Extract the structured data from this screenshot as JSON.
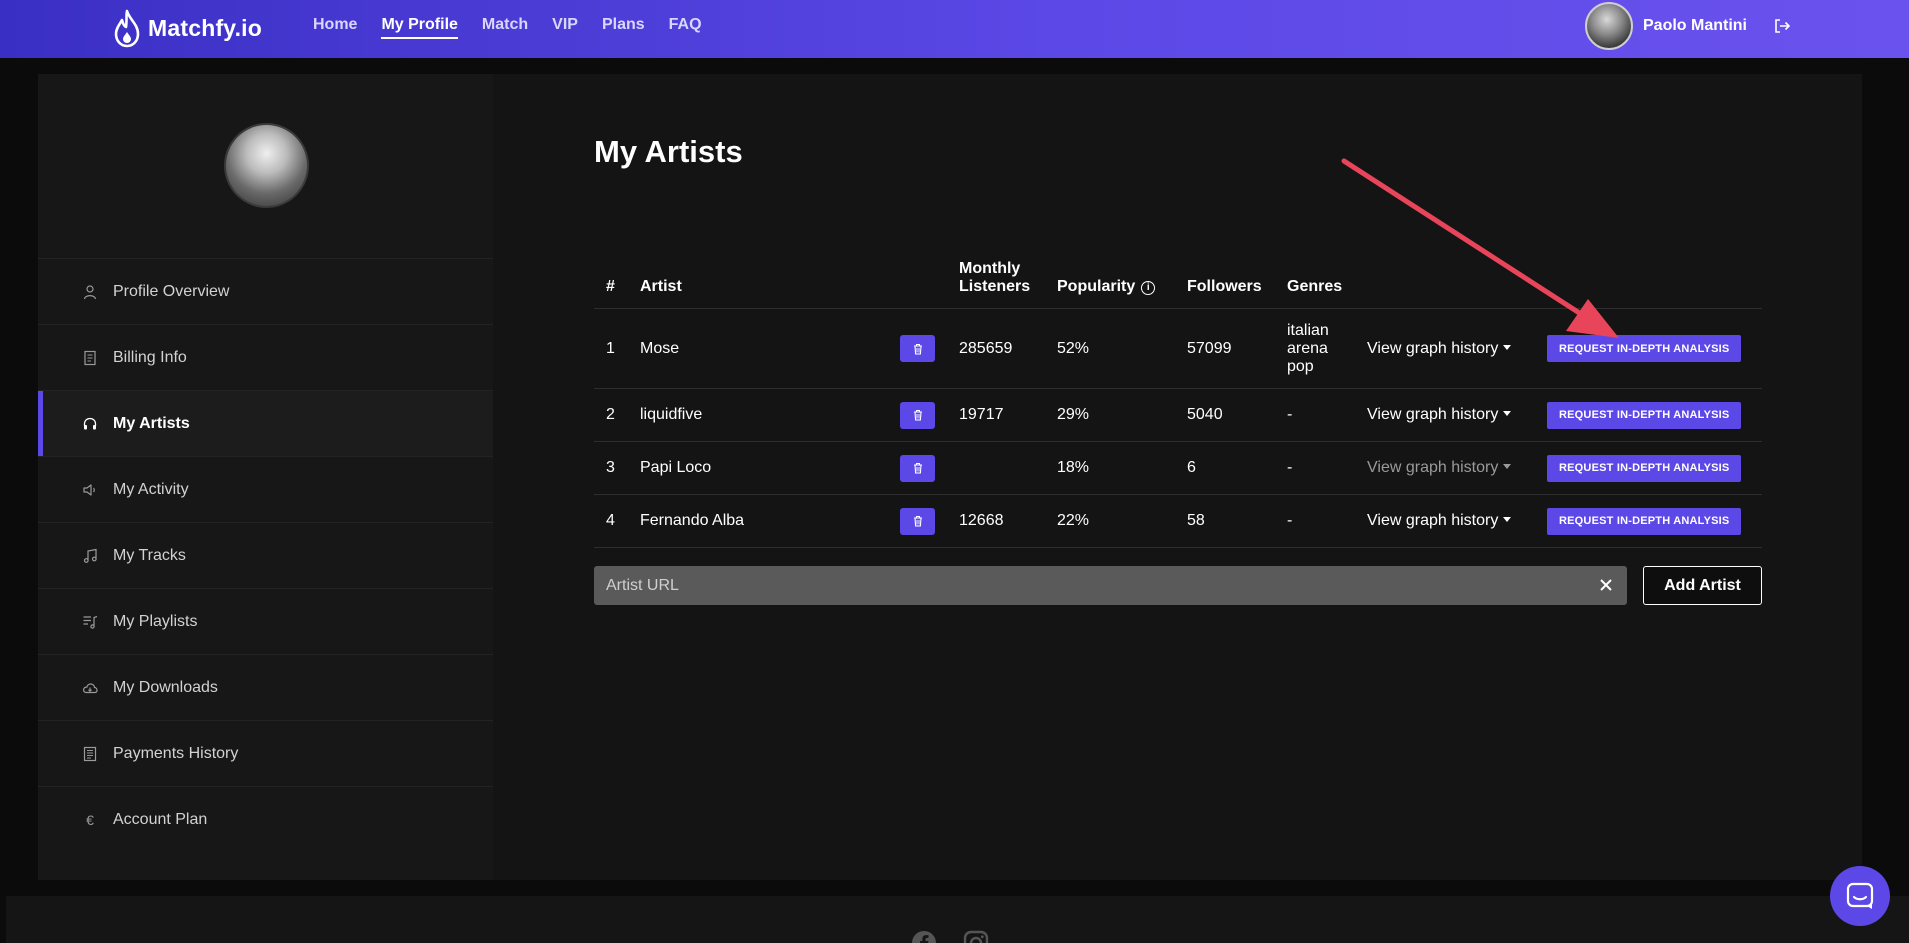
{
  "brand": {
    "name": "Matchfy.io",
    "accent": "#5b48e6"
  },
  "nav": [
    {
      "label": "Home",
      "active": false
    },
    {
      "label": "My Profile",
      "active": true
    },
    {
      "label": "Match",
      "active": false
    },
    {
      "label": "VIP",
      "active": false
    },
    {
      "label": "Plans",
      "active": false
    },
    {
      "label": "FAQ",
      "active": false
    }
  ],
  "user": {
    "name": "Paolo Mantini"
  },
  "sidebar": {
    "items": [
      {
        "label": "Profile Overview",
        "icon": "user-icon",
        "active": false
      },
      {
        "label": "Billing Info",
        "icon": "document-icon",
        "active": false
      },
      {
        "label": "My Artists",
        "icon": "headphones-icon",
        "active": true
      },
      {
        "label": "My Activity",
        "icon": "speaker-icon",
        "active": false
      },
      {
        "label": "My Tracks",
        "icon": "music-note-icon",
        "active": false
      },
      {
        "label": "My Playlists",
        "icon": "playlist-icon",
        "active": false
      },
      {
        "label": "My Downloads",
        "icon": "cloud-download-icon",
        "active": false
      },
      {
        "label": "Payments History",
        "icon": "receipt-icon",
        "active": false
      },
      {
        "label": "Account Plan",
        "icon": "euro-icon",
        "active": false
      }
    ]
  },
  "main": {
    "title": "My Artists",
    "table": {
      "headers": {
        "num": "#",
        "artist": "Artist",
        "monthly_1": "Monthly",
        "monthly_2": "Listeners",
        "popularity": "Popularity",
        "followers": "Followers",
        "genres": "Genres"
      },
      "rows": [
        {
          "num": "1",
          "artist": "Mose",
          "monthly": "285659",
          "popularity": "52%",
          "followers": "57099",
          "genres": [
            "italian",
            "arena",
            "pop"
          ],
          "graph": "View graph history",
          "graph_enabled": true,
          "action": "REQUEST IN-DEPTH ANALYSIS"
        },
        {
          "num": "2",
          "artist": "liquidfive",
          "monthly": "19717",
          "popularity": "29%",
          "followers": "5040",
          "genres": [
            "-"
          ],
          "graph": "View graph history",
          "graph_enabled": true,
          "action": "REQUEST IN-DEPTH ANALYSIS"
        },
        {
          "num": "3",
          "artist": "Papi Loco",
          "monthly": "",
          "popularity": "18%",
          "followers": "6",
          "genres": [
            "-"
          ],
          "graph": "View graph history",
          "graph_enabled": false,
          "action": "REQUEST IN-DEPTH ANALYSIS"
        },
        {
          "num": "4",
          "artist": "Fernando Alba",
          "monthly": "12668",
          "popularity": "22%",
          "followers": "58",
          "genres": [
            "-"
          ],
          "graph": "View graph history",
          "graph_enabled": true,
          "action": "REQUEST IN-DEPTH ANALYSIS"
        }
      ]
    },
    "add": {
      "placeholder": "Artist URL",
      "value": "",
      "button": "Add Artist"
    }
  },
  "annotation": {
    "color": "#e8455a"
  },
  "footer": {
    "icons": [
      "facebook-icon",
      "instagram-icon"
    ]
  }
}
